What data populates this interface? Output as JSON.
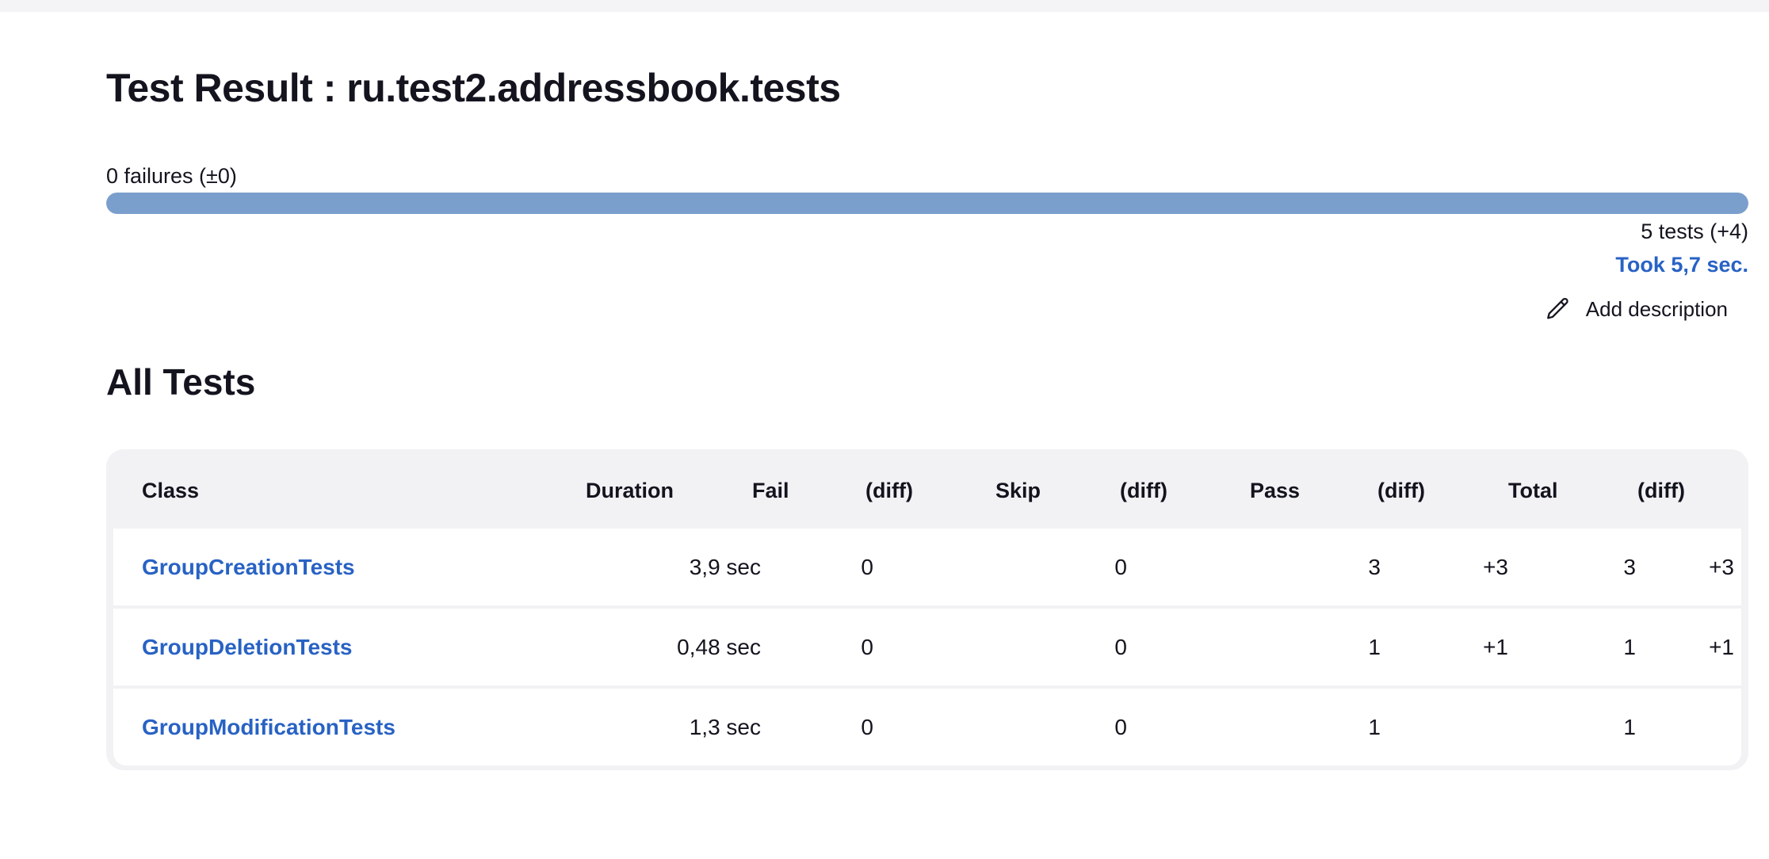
{
  "header": {
    "title": "Test Result : ru.test2.addressbook.tests"
  },
  "summary": {
    "failures_text": "0 failures (±0)",
    "pass_fraction": 1.0,
    "tests_text": "5 tests (+4)",
    "took_text": "Took 5,7 sec.",
    "add_description_label": "Add description",
    "bar_color": "#7b9fcd"
  },
  "all_tests": {
    "title": "All Tests",
    "columns": {
      "class": "Class",
      "duration": "Duration",
      "fail": "Fail",
      "fail_diff": "(diff)",
      "skip": "Skip",
      "skip_diff": "(diff)",
      "pass": "Pass",
      "pass_diff": "(diff)",
      "total": "Total",
      "total_diff": "(diff)"
    },
    "rows": [
      {
        "class": "GroupCreationTests",
        "duration": "3,9 sec",
        "fail": "0",
        "fail_diff": "",
        "skip": "0",
        "skip_diff": "",
        "pass": "3",
        "pass_diff": "+3",
        "total": "3",
        "total_diff": "+3"
      },
      {
        "class": "GroupDeletionTests",
        "duration": "0,48 sec",
        "fail": "0",
        "fail_diff": "",
        "skip": "0",
        "skip_diff": "",
        "pass": "1",
        "pass_diff": "+1",
        "total": "1",
        "total_diff": "+1"
      },
      {
        "class": "GroupModificationTests",
        "duration": "1,3 sec",
        "fail": "0",
        "fail_diff": "",
        "skip": "0",
        "skip_diff": "",
        "pass": "1",
        "pass_diff": "",
        "total": "1",
        "total_diff": ""
      }
    ]
  },
  "colors": {
    "link": "#2862c4",
    "card_bg": "#f2f2f5"
  },
  "icons": {
    "add_description": "pencil-icon"
  }
}
